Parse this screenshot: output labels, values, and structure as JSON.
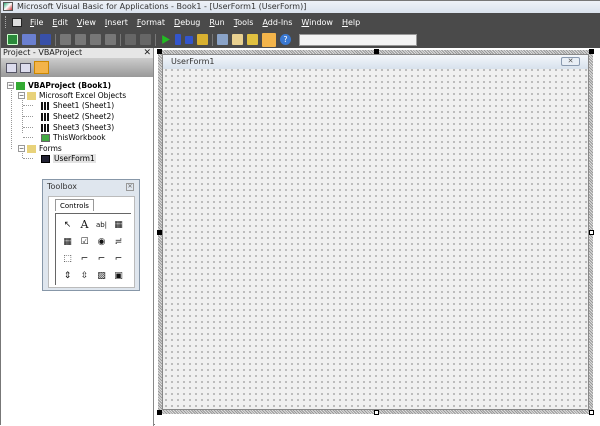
{
  "window": {
    "title": "Microsoft Visual Basic for Applications - Book1 - [UserForm1 (UserForm)]"
  },
  "menu": [
    "File",
    "Edit",
    "View",
    "Insert",
    "Format",
    "Debug",
    "Run",
    "Tools",
    "Add-Ins",
    "Window",
    "Help"
  ],
  "toolbar": {
    "buttons": [
      "view-excel-icon",
      "insert-userform-icon",
      "save-icon",
      "cut-icon",
      "copy-icon",
      "paste-icon",
      "find-icon",
      "undo-icon",
      "redo-icon",
      "run-icon",
      "break-icon",
      "reset-icon",
      "design-mode-icon",
      "project-explorer-icon",
      "properties-icon",
      "object-browser-icon",
      "toolbox-icon",
      "help-icon"
    ],
    "combo_value": ""
  },
  "project": {
    "title": "Project - VBAProject",
    "close": "✕",
    "tree": {
      "root": "VBAProject (Book1)",
      "excel_objects": "Microsoft Excel Objects",
      "sheets": [
        "Sheet1 (Sheet1)",
        "Sheet2 (Sheet2)",
        "Sheet3 (Sheet3)",
        "ThisWorkbook"
      ],
      "forms": "Forms",
      "userform": "UserForm1"
    }
  },
  "form": {
    "title": "UserForm1",
    "close": "✕"
  },
  "toolbox": {
    "title": "Toolbox",
    "tab": "Controls",
    "tools": [
      "↖",
      "A",
      "ab|",
      "▦",
      "▦",
      "☑",
      "◉",
      "≓",
      "⬚",
      "⌐",
      "⌐",
      "⌐",
      "⇕",
      "⇳",
      "▨",
      "▣"
    ]
  }
}
